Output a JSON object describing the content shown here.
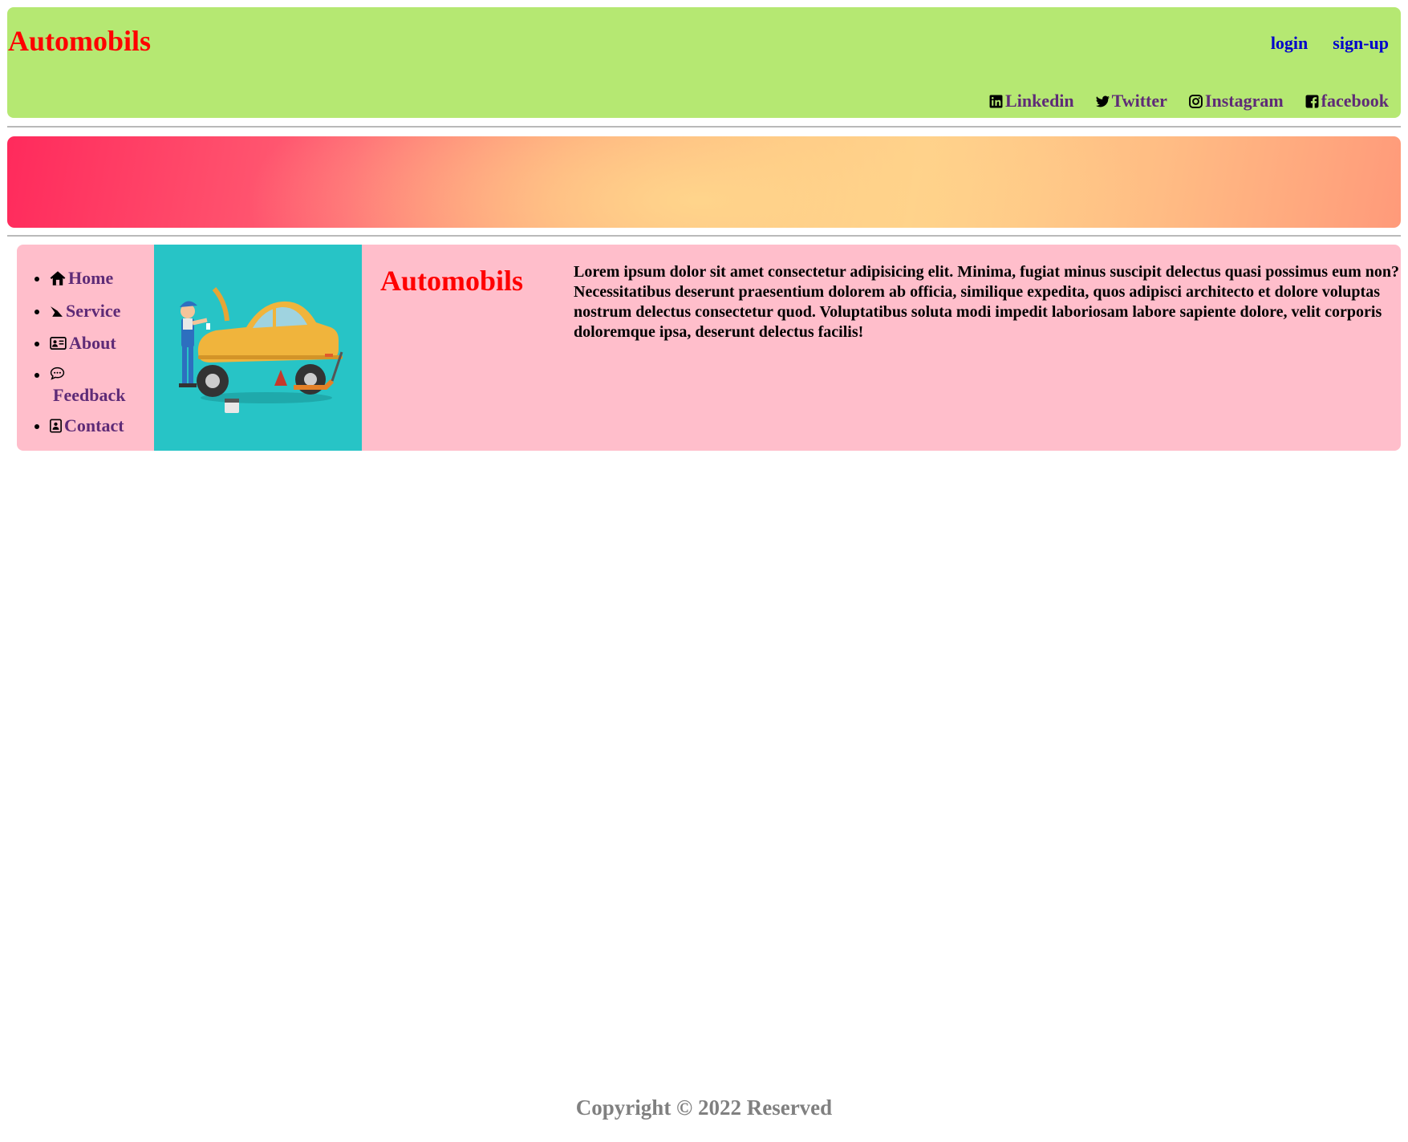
{
  "header": {
    "brand": "Automobils",
    "auth": {
      "login": "login",
      "signup": "sign-up"
    },
    "social": [
      {
        "label": "Linkedin",
        "icon": "linkedin-icon"
      },
      {
        "label": "Twitter",
        "icon": "twitter-icon"
      },
      {
        "label": "Instagram",
        "icon": "instagram-icon"
      },
      {
        "label": "facebook",
        "icon": "facebook-icon"
      }
    ]
  },
  "sidebar": {
    "items": [
      {
        "label": "Home",
        "icon": "home-icon"
      },
      {
        "label": "Service",
        "icon": "service-icon"
      },
      {
        "label": "About",
        "icon": "id-card-icon"
      },
      {
        "label": "Feedback",
        "icon": "chat-bubble-icon"
      },
      {
        "label": "Contact",
        "icon": "contact-icon"
      }
    ]
  },
  "main": {
    "title": "Automobils",
    "paragraph": "Lorem ipsum dolor sit amet consectetur adipisicing elit. Minima, fugiat minus suscipit delectus quasi possimus eum non? Necessitatibus deserunt praesentium dolorem ab officia, similique expedita, quos adipisci architecto et dolore voluptas nostrum delectus consectetur quod. Voluptatibus soluta modi impedit laboriosam labore sapiente dolore, velit corporis doloremque ipsa, deserunt delectus facilis!"
  },
  "footer": {
    "text": "Copyright © 2022 Reserved"
  },
  "colors": {
    "header_bg": "#b5e872",
    "brand": "#ff0000",
    "auth_link": "#0000cc",
    "nav_link": "#5e2b77",
    "content_bg": "#ffbecb",
    "hero_bg": "#27c4c6",
    "footer_text": "#808080"
  }
}
